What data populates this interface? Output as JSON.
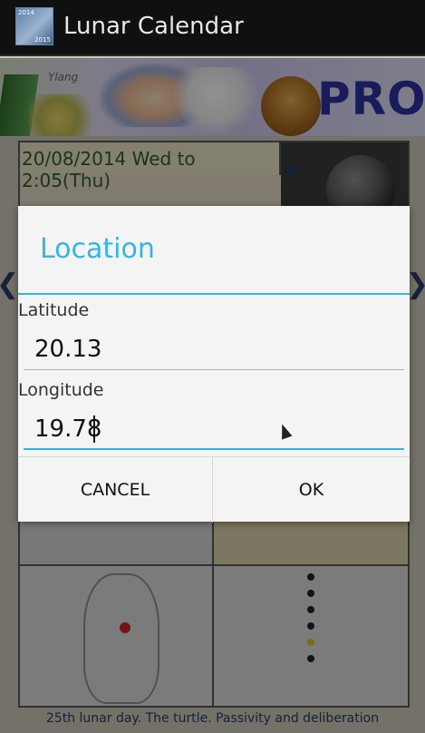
{
  "app": {
    "title": "Lunar Calendar",
    "icon_years": [
      "2014",
      "2015"
    ]
  },
  "banner": {
    "ylang_text": "Ylang",
    "pro_text": "PRO"
  },
  "calendar": {
    "date_range": "20/08/2014 Wed to 2:05(Thu)",
    "footer_text": "25th lunar day. The turtle. Passivity and deliberation"
  },
  "dialog": {
    "title": "Location",
    "latitude_label": "Latitude",
    "latitude_value": "20.13",
    "longitude_label": "Longitude",
    "longitude_value": "19.78",
    "cancel_label": "CANCEL",
    "ok_label": "OK"
  },
  "colors": {
    "accent": "#33b5e5",
    "actionbar": "#101010"
  },
  "icons": {
    "nav_left": "chevron-left-icon",
    "nav_right": "chevron-right-icon",
    "moon_toggle": "chevron-down-icon"
  }
}
